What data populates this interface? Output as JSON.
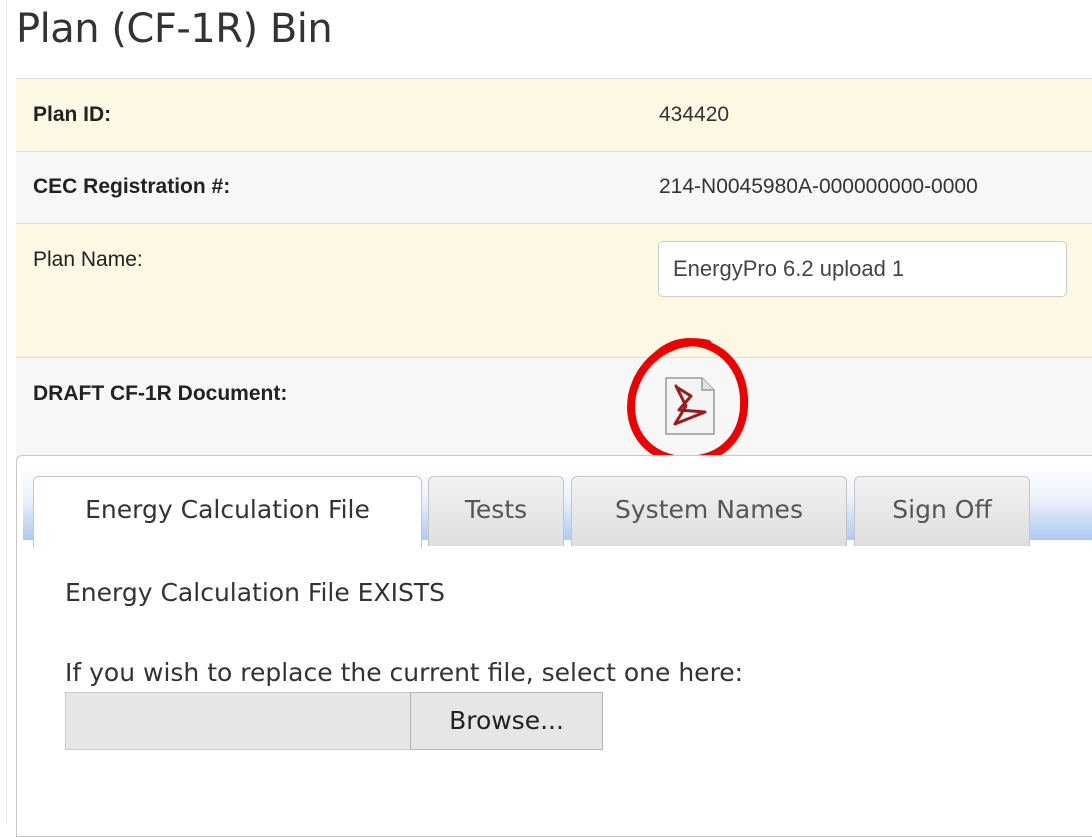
{
  "page": {
    "title": "Plan (CF-1R) Bin"
  },
  "info": {
    "plan_id_label": "Plan ID:",
    "plan_id_value": "434420",
    "cec_label": "CEC Registration #:",
    "cec_value": "214-N0045980A-000000000-0000",
    "plan_name_label": "Plan Name:",
    "plan_name_value": "EnergyPro 6.2 upload 1",
    "draft_label": "DRAFT CF-1R Document:",
    "draft_icon": "pdf-document-icon"
  },
  "tabs": [
    {
      "label": "Energy Calculation File",
      "active": true
    },
    {
      "label": "Tests",
      "active": false
    },
    {
      "label": "System Names",
      "active": false
    },
    {
      "label": "Sign Off",
      "active": false
    }
  ],
  "energy_tab": {
    "status_text": "Energy Calculation File EXISTS",
    "replace_prompt": "If you wish to replace the current file, select one here:",
    "browse_label": "Browse..."
  },
  "colors": {
    "row_highlight": "#fcf8e3",
    "row_alt": "#f7f7f7",
    "annotation": "#ee0000",
    "tab_bar_gradient_end": "#aecaf2",
    "pdf_red": "#9b1b1b"
  }
}
